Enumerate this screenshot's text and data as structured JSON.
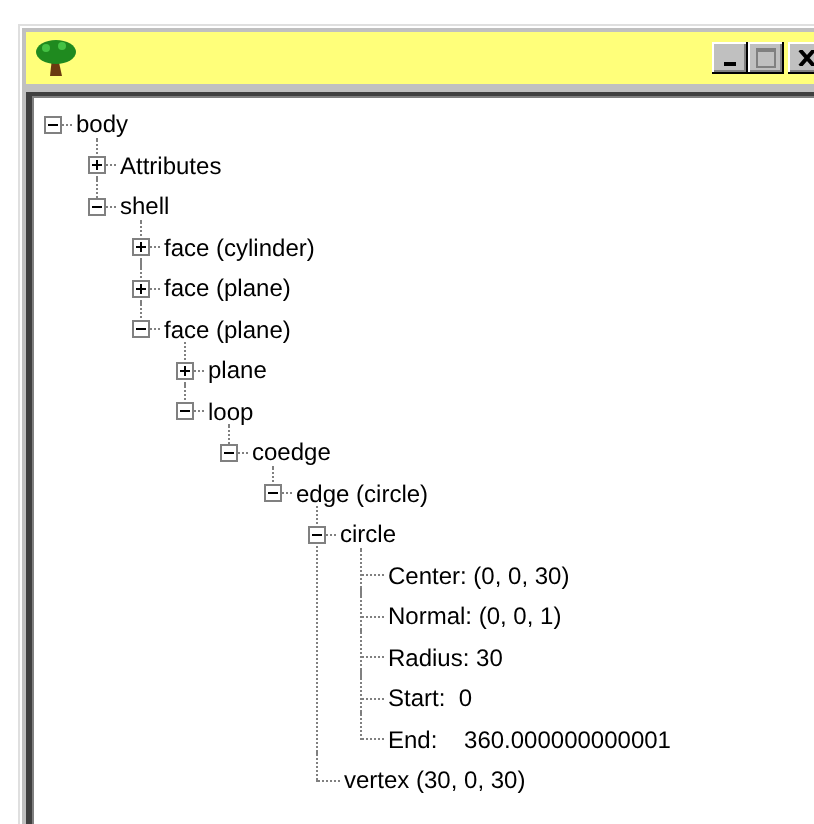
{
  "tree": [
    {
      "label": "body",
      "expanded": true,
      "children": [
        {
          "label": "Attributes",
          "expanded": false
        },
        {
          "label": "shell",
          "expanded": true,
          "children": [
            {
              "label": "face (cylinder)",
              "expanded": false
            },
            {
              "label": "face (plane)",
              "expanded": false
            },
            {
              "label": "face (plane)",
              "expanded": true,
              "children": [
                {
                  "label": "plane",
                  "expanded": false
                },
                {
                  "label": "loop",
                  "expanded": true,
                  "children": [
                    {
                      "label": "coedge",
                      "expanded": true,
                      "children": [
                        {
                          "label": "edge (circle)",
                          "expanded": true,
                          "children": [
                            {
                              "label": "circle",
                              "expanded": true,
                              "children": [
                                {
                                  "label": "Center: (0, 0, 30)"
                                },
                                {
                                  "label": "Normal: (0, 0, 1)"
                                },
                                {
                                  "label": "Radius: 30"
                                },
                                {
                                  "label": "Start:  0"
                                },
                                {
                                  "label": "End:    360.000000000001"
                                }
                              ]
                            },
                            {
                              "label": "vertex (30, 0, 30)"
                            }
                          ]
                        }
                      ]
                    }
                  ]
                }
              ]
            }
          ]
        }
      ]
    }
  ]
}
